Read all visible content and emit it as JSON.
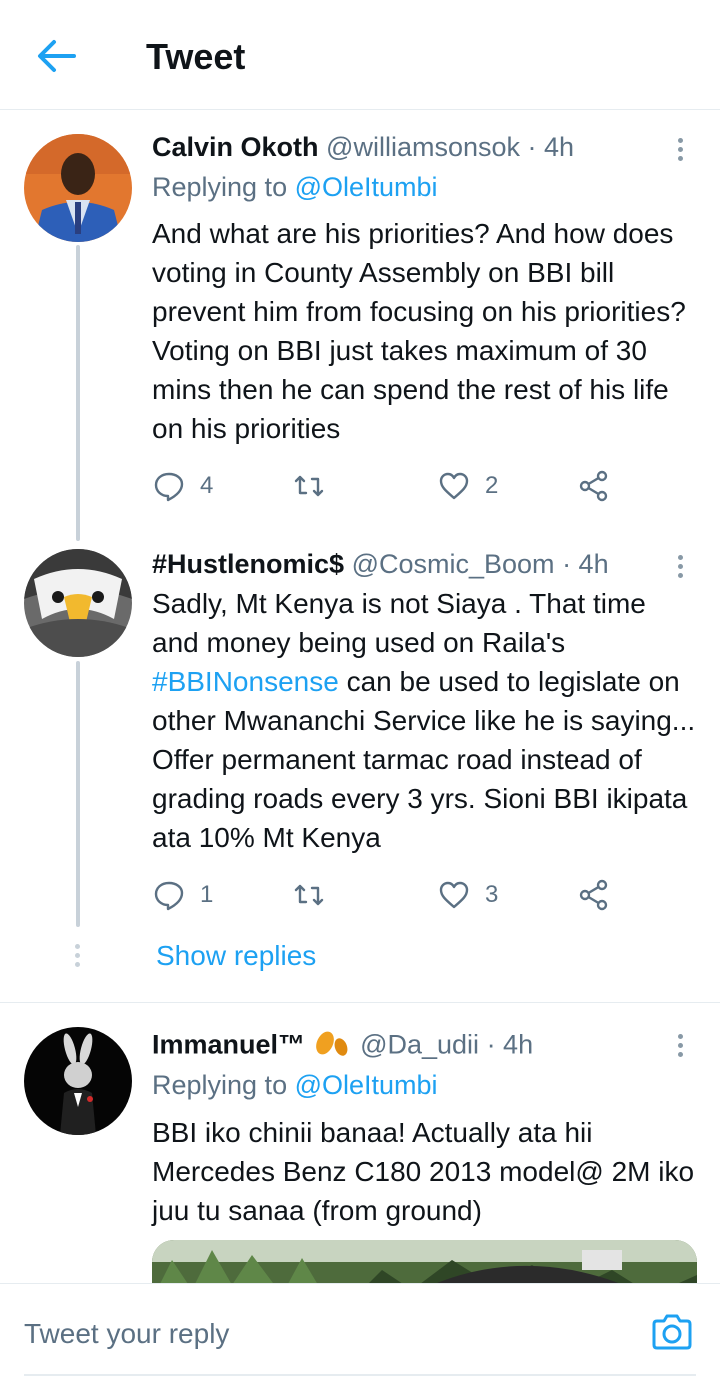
{
  "header": {
    "title": "Tweet",
    "back_icon": "arrow-left-icon"
  },
  "colors": {
    "accent": "#1da1f2",
    "text": "#0f1419",
    "muted": "#5b7083",
    "divider": "#e6ecf0"
  },
  "tweets": [
    {
      "name": "Calvin Okoth",
      "handle": "@williamsonsok",
      "time": "· 4h",
      "replying_label": "Replying to",
      "replying_handle": "@OleItumbi",
      "text": "And what are his priorities? And how does voting in County Assembly on BBI bill prevent him from focusing on his priorities? Voting on BBI just takes maximum of 30 mins then he can spend the rest of his life on his priorities",
      "replies": "4",
      "retweets": "",
      "likes": "2"
    },
    {
      "name": "#Hustlenomic$",
      "handle": "@Cosmic_Boom",
      "time": "· 4h",
      "text_before": "Sadly, Mt Kenya is not Siaya . That time and money being used on Raila's",
      "hashtag": "#BBINonsense",
      "text_after": "can be used to legislate on other Mwananchi Service like he is saying... Offer permanent tarmac road instead of grading roads every 3 yrs. Sioni BBI ikipata ata 10% Mt Kenya",
      "replies": "1",
      "retweets": "",
      "likes": "3"
    },
    {
      "name": "Immanuel™",
      "handle": "@Da_udii",
      "time": "· 4h",
      "replying_label": "Replying to",
      "replying_handle": "@OleItumbi",
      "text": "BBI iko chinii banaa! Actually ata hii Mercedes Benz C180 2013 model@ 2M iko juu tu sanaa (from ground)"
    }
  ],
  "show_replies": "Show replies",
  "reply_bar": {
    "placeholder": "Tweet your reply",
    "camera_icon": "camera-icon"
  }
}
